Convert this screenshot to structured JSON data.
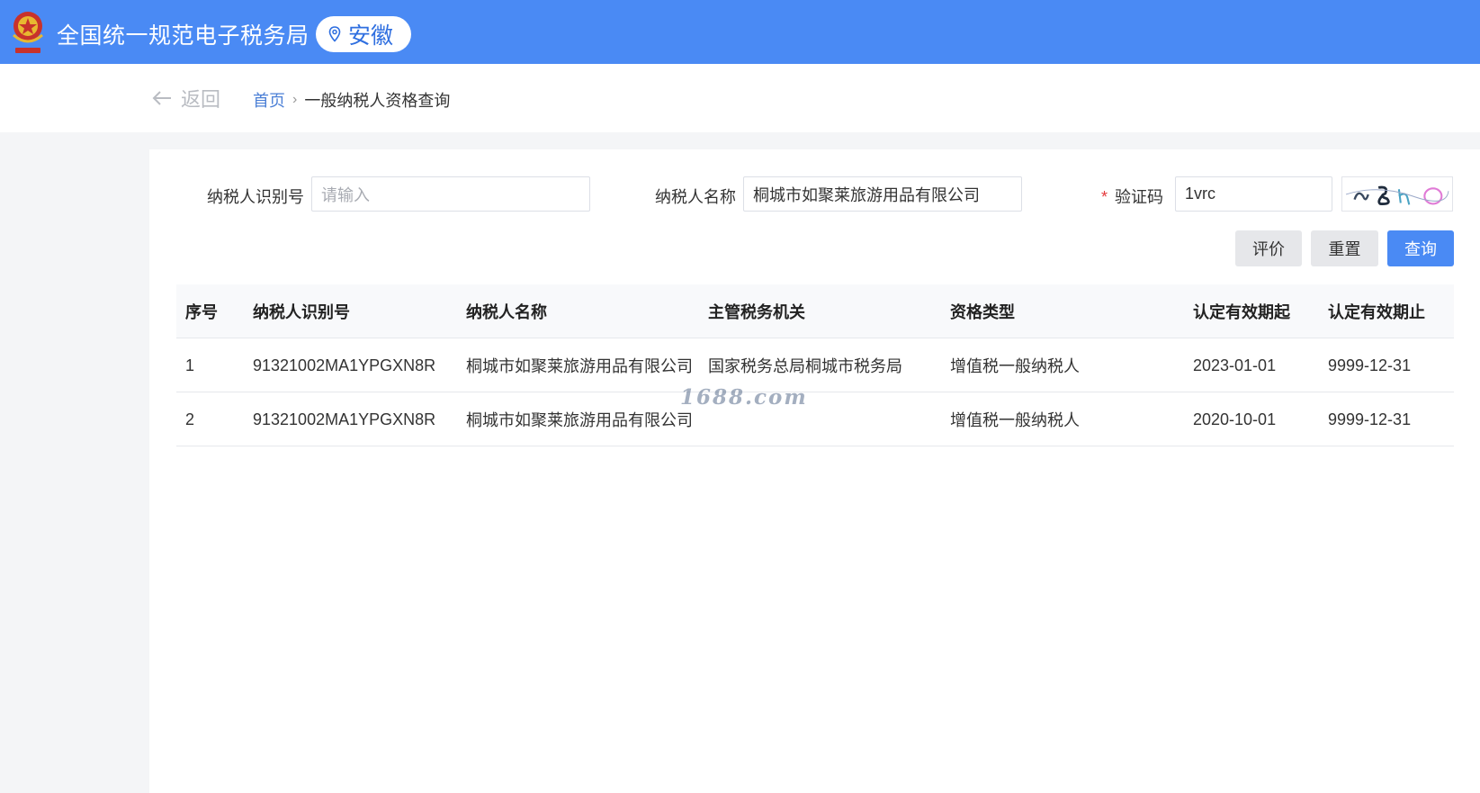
{
  "header": {
    "title": "全国统一规范电子税务局",
    "region": "安徽",
    "bg_color": "#4a8af4"
  },
  "nav": {
    "back_label": "返回",
    "breadcrumb": [
      "首页",
      "一般纳税人资格查询"
    ],
    "separator": "›"
  },
  "form": {
    "taxpayer_id": {
      "label": "纳税人识别号",
      "placeholder": "请输入",
      "value": ""
    },
    "taxpayer_name": {
      "label": "纳税人名称",
      "value": "桐城市如聚莱旅游用品有限公司"
    },
    "captcha": {
      "label": "验证码",
      "required_mark": "*",
      "value": "1vrc"
    }
  },
  "buttons": {
    "rate": "评价",
    "reset": "重置",
    "query": "查询"
  },
  "table": {
    "columns": [
      "序号",
      "纳税人识别号",
      "纳税人名称",
      "主管税务机关",
      "资格类型",
      "认定有效期起",
      "认定有效期止"
    ],
    "rows": [
      [
        "1",
        "91321002MA1YPGXN8R",
        "桐城市如聚莱旅游用品有限公司",
        "国家税务总局桐城市税务局",
        "增值税一般纳税人",
        "2023-01-01",
        "9999-12-31"
      ],
      [
        "2",
        "91321002MA1YPGXN8R",
        "桐城市如聚莱旅游用品有限公司",
        "",
        "增值税一般纳税人",
        "2020-10-01",
        "9999-12-31"
      ]
    ]
  },
  "watermark": "1688.com"
}
